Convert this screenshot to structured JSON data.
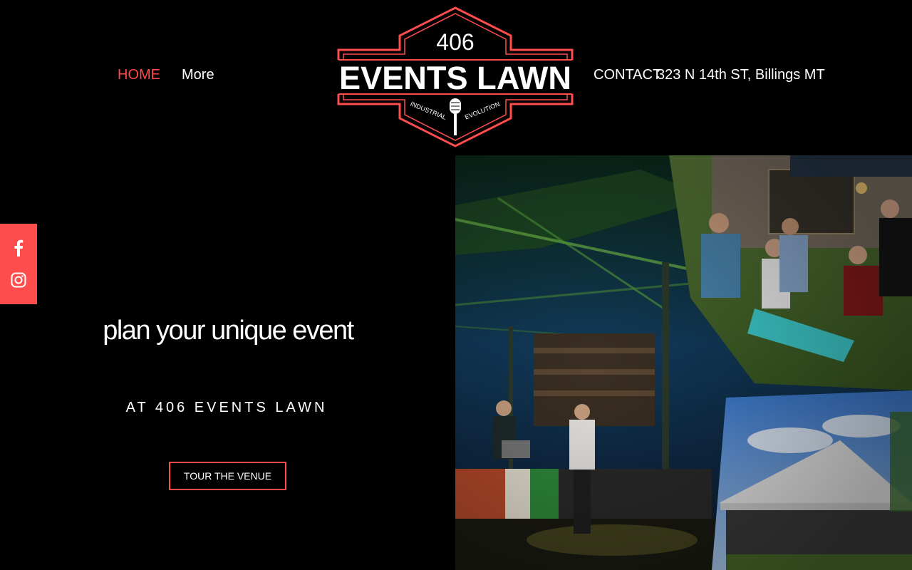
{
  "nav": {
    "home_label": "HOME",
    "more_label": "More",
    "contact_label": "CONTACT",
    "address": "323 N 14th ST, Billings MT"
  },
  "logo": {
    "number": "406",
    "name": "EVENTS LAWN",
    "tagline_left": "INDUSTRIAL",
    "tagline_right": "EVOLUTION"
  },
  "social": {
    "icons": [
      "facebook-icon",
      "instagram-icon"
    ]
  },
  "hero": {
    "title": "plan your unique event",
    "subtitle": "AT 406 EVENTS LAWN",
    "cta_label": "TOUR THE VENUE"
  },
  "colors": {
    "accent": "#ff4d4d",
    "background": "#000000",
    "text": "#ffffff"
  }
}
